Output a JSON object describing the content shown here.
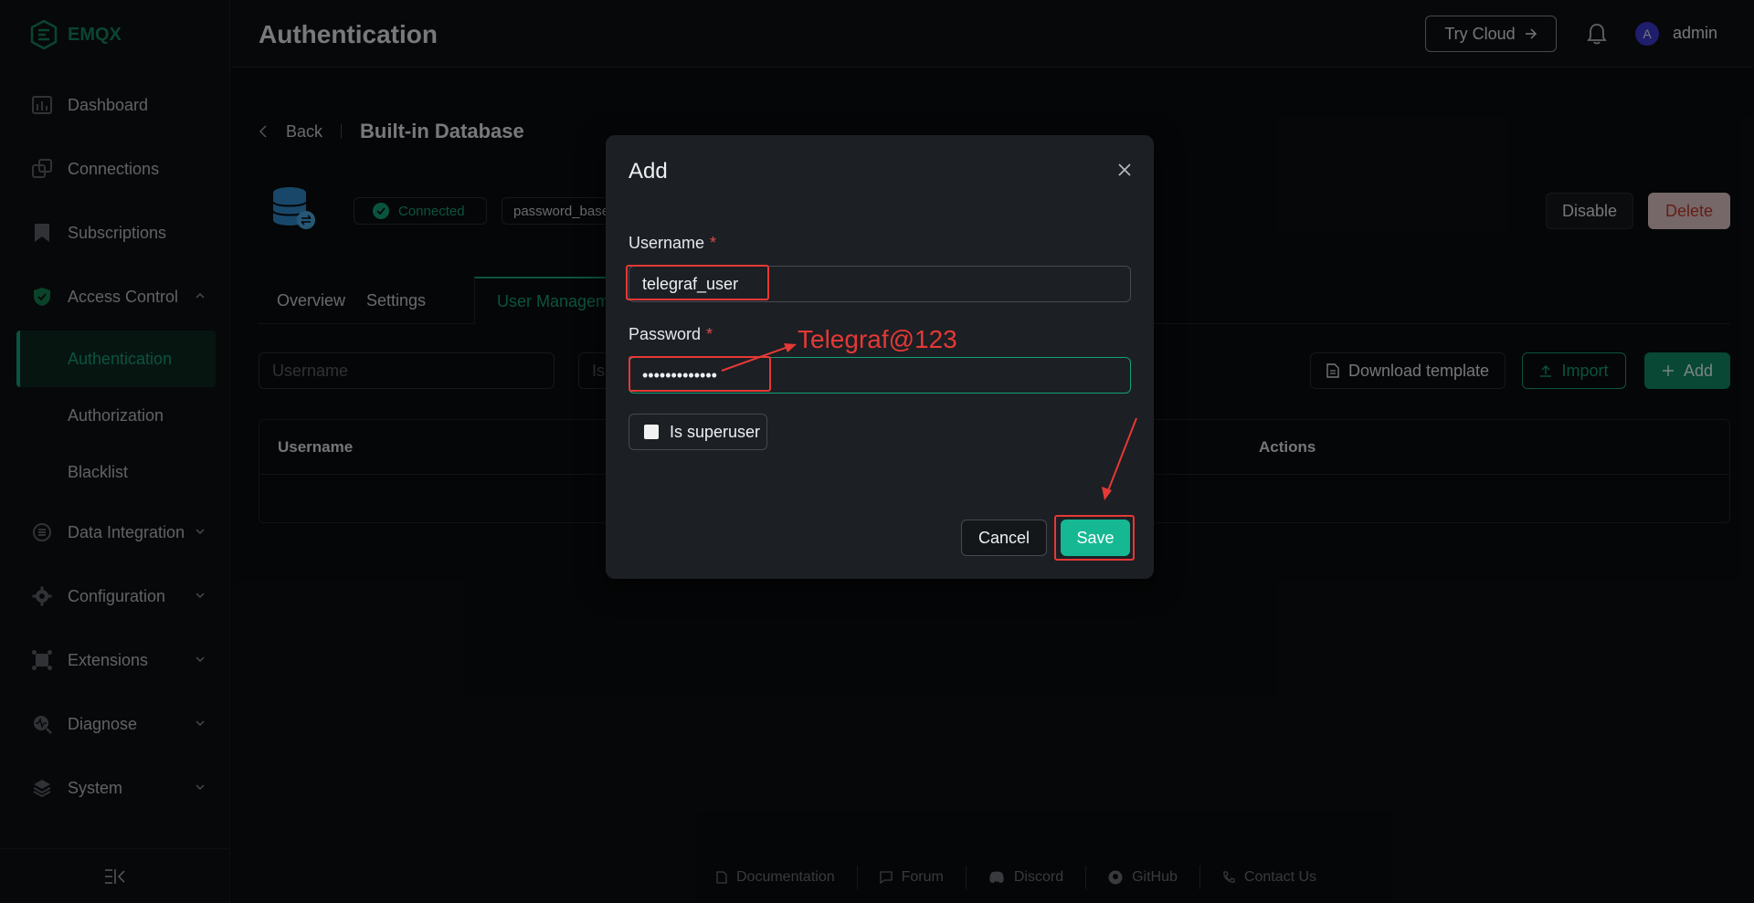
{
  "app": {
    "logo_text": "EMQX"
  },
  "header": {
    "title": "Authentication",
    "try_cloud": "Try Cloud",
    "user": "admin",
    "avatar_letter": "A"
  },
  "sidebar": {
    "items": [
      {
        "label": "Dashboard",
        "icon": "dashboard-icon"
      },
      {
        "label": "Connections",
        "icon": "connections-icon"
      },
      {
        "label": "Subscriptions",
        "icon": "bookmark-icon"
      },
      {
        "label": "Access Control",
        "icon": "shield-check-icon",
        "expanded": true
      },
      {
        "label": "Data Integration",
        "icon": "data-integration-icon"
      },
      {
        "label": "Configuration",
        "icon": "gear-icon"
      },
      {
        "label": "Extensions",
        "icon": "extensions-icon"
      },
      {
        "label": "Diagnose",
        "icon": "diagnose-icon"
      },
      {
        "label": "System",
        "icon": "layers-icon"
      }
    ],
    "sub_items": [
      {
        "label": "Authentication",
        "active": true
      },
      {
        "label": "Authorization"
      },
      {
        "label": "Blacklist"
      }
    ]
  },
  "main": {
    "back": "Back",
    "db_title": "Built-in Database",
    "status": "Connected",
    "mechanism": "password_based",
    "disable": "Disable",
    "delete": "Delete",
    "tabs": [
      "Overview",
      "Settings",
      "User Management"
    ],
    "filter_placeholder": "Username",
    "filter2_placeholder": "Is",
    "download_template": "Download template",
    "import": "Import",
    "add": "Add",
    "table_headers": [
      "Username",
      "Actions"
    ]
  },
  "dialog": {
    "title": "Add",
    "username_label": "Username",
    "username_value": "telegraf_user",
    "password_label": "Password",
    "password_value": "•••••••••••••",
    "superuser_label": "Is superuser",
    "cancel": "Cancel",
    "save": "Save"
  },
  "annotation": {
    "text": "Telegraf@123",
    "color": "#e53935"
  },
  "footer": [
    "Documentation",
    "Forum",
    "Discord",
    "GitHub",
    "Contact Us"
  ],
  "colors": {
    "accent": "#14a07a",
    "save": "#16b894",
    "danger": "#c0392b"
  }
}
